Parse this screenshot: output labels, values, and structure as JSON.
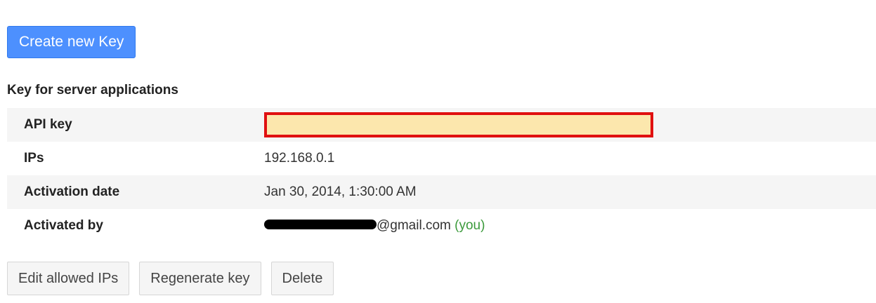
{
  "toolbar": {
    "create_label": "Create new Key"
  },
  "section": {
    "title": "Key for server applications"
  },
  "details": [
    {
      "label": "API key",
      "value": ""
    },
    {
      "label": "IPs",
      "value": "192.168.0.1"
    },
    {
      "label": "Activation date",
      "value": "Jan 30, 2014, 1:30:00 AM"
    },
    {
      "label": "Activated by",
      "email_suffix": "@gmail.com",
      "you_label": "(you)"
    }
  ],
  "actions": {
    "edit_label": "Edit allowed IPs",
    "regenerate_label": "Regenerate key",
    "delete_label": "Delete"
  },
  "colors": {
    "primary_button": "#4d90fe",
    "highlight_border": "#e01010",
    "highlight_fill": "#fce7ad",
    "you_text": "#3b9a3b"
  }
}
